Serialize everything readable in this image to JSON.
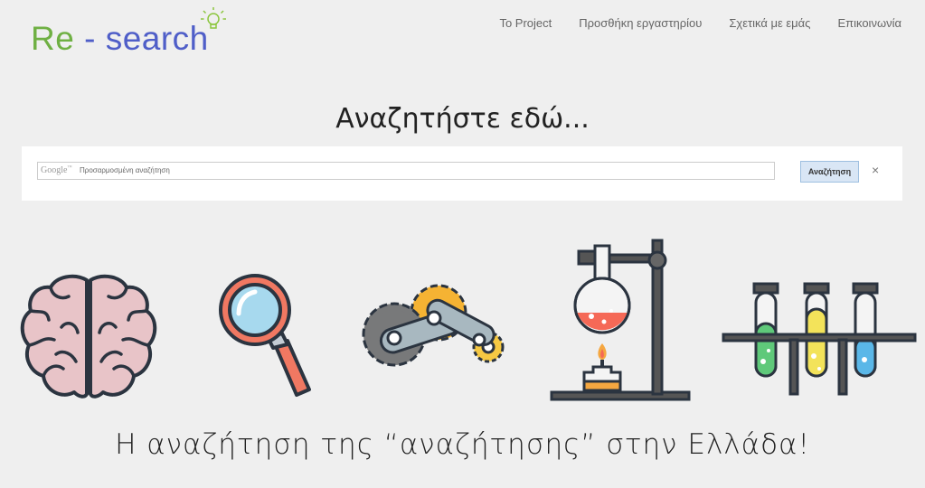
{
  "logo": {
    "re": "Re",
    "rest": " - search"
  },
  "nav": [
    "To Project",
    "Προσθήκη εργαστηρίου",
    "Σχετικά με εμάς",
    "Επικοινωνία"
  ],
  "heading": "Αναζητήστε εδώ...",
  "search": {
    "brand": "Google",
    "placeholder": "Προσαρμοσμένη αναζήτηση",
    "button": "Αναζήτηση",
    "clear": "×"
  },
  "tagline": "Η αναζήτηση της “αναζήτησης” στην Ελλάδα!",
  "colors": {
    "logo_green": "#6fb043",
    "logo_blue": "#4f5ec8",
    "background": "#efefef"
  }
}
